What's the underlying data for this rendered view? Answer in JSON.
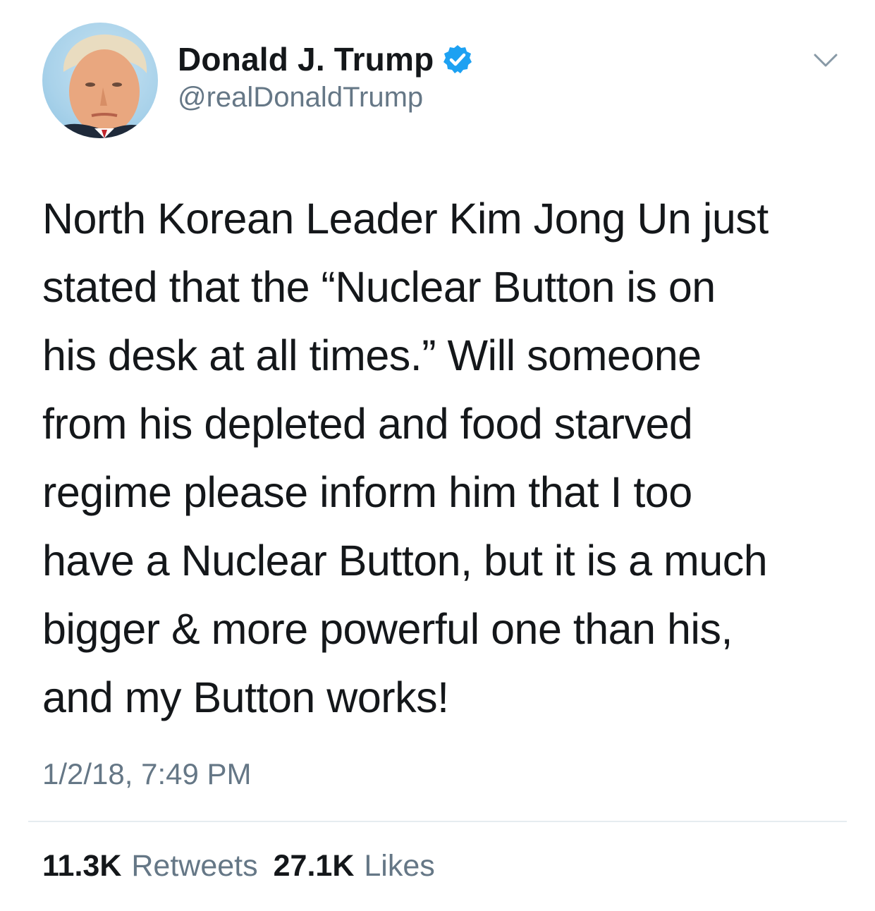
{
  "colors": {
    "text": "#14171a",
    "secondary": "#657786",
    "verified": "#1da1f2",
    "divider": "#e6ecf0"
  },
  "tweet": {
    "display_name": "Donald J. Trump",
    "verified_icon": "verified-badge-icon",
    "handle": "@realDonaldTrump",
    "menu_icon": "chevron-down-icon",
    "text_lines": [
      "North Korean Leader Kim Jong Un just",
      "stated that the “Nuclear Button is on",
      "his desk at all times.” Will someone",
      "from his depleted and food starved",
      "regime please inform him that I too",
      "have a Nuclear Button, but it is a much",
      "bigger & more powerful one than his,",
      "and my Button works!"
    ],
    "timestamp": "1/2/18, 7:49 PM",
    "retweets_count": "11.3K",
    "retweets_label": "Retweets",
    "likes_count": "27.1K",
    "likes_label": "Likes"
  }
}
